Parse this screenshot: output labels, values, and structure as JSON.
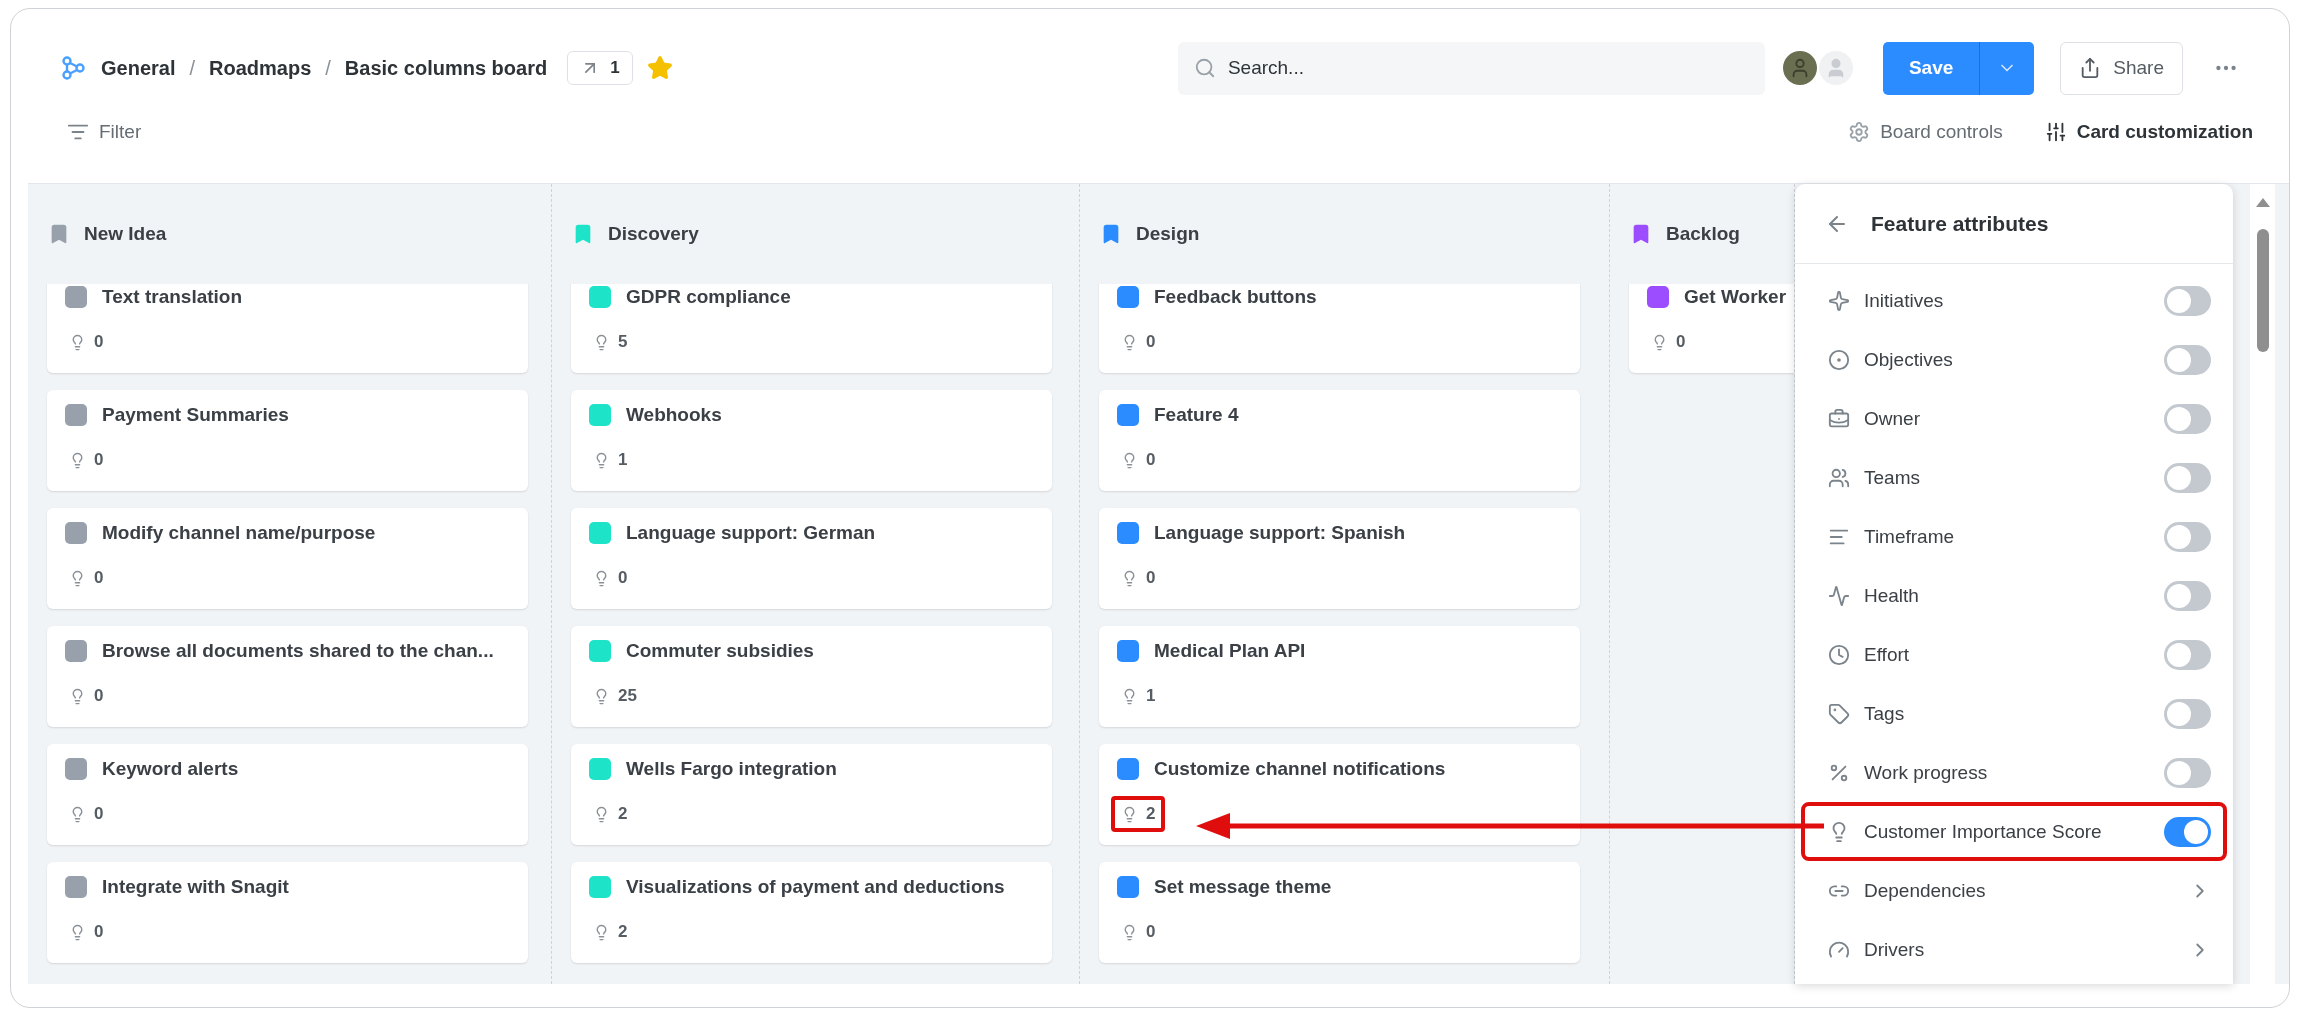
{
  "breadcrumb": [
    {
      "kind": "item",
      "text": "General"
    },
    {
      "kind": "separator",
      "text": "/"
    },
    {
      "kind": "item",
      "text": "Roadmaps"
    },
    {
      "kind": "separator",
      "text": "/"
    },
    {
      "kind": "item",
      "text": "Basic columns board"
    }
  ],
  "link_count": "1",
  "starred": true,
  "search": {
    "placeholder": "Search..."
  },
  "save_button": "Save",
  "share_button": "Share",
  "filter": "Filter",
  "board_controls": "Board controls",
  "card_customization": "Card customization",
  "columns": [
    {
      "title": "New Idea",
      "color": "#97a0ab",
      "cards": [
        {
          "title": "Text translation",
          "count": "0",
          "highlighted": false
        },
        {
          "title": "Payment Summaries",
          "count": "0",
          "highlighted": false
        },
        {
          "title": "Modify channel name/purpose",
          "count": "0",
          "highlighted": false
        },
        {
          "title": "Browse all documents shared to the chan...",
          "count": "0",
          "highlighted": false
        },
        {
          "title": "Keyword alerts",
          "count": "0",
          "highlighted": false
        },
        {
          "title": "Integrate with Snagit",
          "count": "0",
          "highlighted": false
        }
      ]
    },
    {
      "title": "Discovery",
      "color": "#1de3c8",
      "cards": [
        {
          "title": "GDPR compliance",
          "count": "5",
          "highlighted": false
        },
        {
          "title": "Webhooks",
          "count": "1",
          "highlighted": false
        },
        {
          "title": "Language support: German",
          "count": "0",
          "highlighted": false
        },
        {
          "title": "Commuter subsidies",
          "count": "25",
          "highlighted": false
        },
        {
          "title": "Wells Fargo integration",
          "count": "2",
          "highlighted": false
        },
        {
          "title": "Visualizations of payment and deductions",
          "count": "2",
          "highlighted": false
        }
      ]
    },
    {
      "title": "Design",
      "color": "#2b8cff",
      "cards": [
        {
          "title": "Feedback buttons",
          "count": "0",
          "highlighted": false
        },
        {
          "title": "Feature 4",
          "count": "0",
          "highlighted": false
        },
        {
          "title": "Language support: Spanish",
          "count": "0",
          "highlighted": false
        },
        {
          "title": "Medical Plan API",
          "count": "1",
          "highlighted": false
        },
        {
          "title": "Customize channel notifications",
          "count": "2",
          "highlighted": true
        },
        {
          "title": "Set message theme",
          "count": "0",
          "highlighted": false
        }
      ]
    },
    {
      "title": "Backlog",
      "color": "#9b4dff",
      "cards": [
        {
          "title": "Get Worker",
          "count": "0",
          "highlighted": false
        }
      ]
    }
  ],
  "panel": {
    "title": "Feature attributes",
    "attributes": [
      {
        "label": "Initiatives",
        "kind": "toggle",
        "on": false,
        "highlighted": false
      },
      {
        "label": "Objectives",
        "kind": "toggle",
        "on": false,
        "highlighted": false
      },
      {
        "label": "Owner",
        "kind": "toggle",
        "on": false,
        "highlighted": false
      },
      {
        "label": "Teams",
        "kind": "toggle",
        "on": false,
        "highlighted": false
      },
      {
        "label": "Timeframe",
        "kind": "toggle",
        "on": false,
        "highlighted": false
      },
      {
        "label": "Health",
        "kind": "toggle",
        "on": false,
        "highlighted": false
      },
      {
        "label": "Effort",
        "kind": "toggle",
        "on": false,
        "highlighted": false
      },
      {
        "label": "Tags",
        "kind": "toggle",
        "on": false,
        "highlighted": false
      },
      {
        "label": "Work progress",
        "kind": "toggle",
        "on": false,
        "highlighted": false
      },
      {
        "label": "Customer Importance Score",
        "kind": "toggle",
        "on": true,
        "highlighted": true
      },
      {
        "label": "Dependencies",
        "kind": "submenu",
        "highlighted": false
      },
      {
        "label": "Drivers",
        "kind": "submenu",
        "highlighted": false
      }
    ]
  },
  "annotation_arrow": true
}
